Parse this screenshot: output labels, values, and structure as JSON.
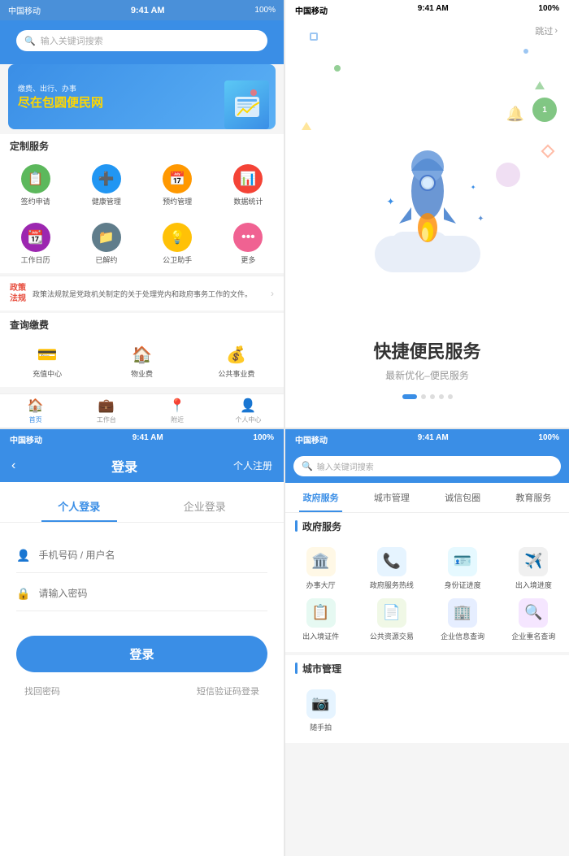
{
  "panel1": {
    "status": {
      "carrier": "中国移动",
      "time": "9:41 AM",
      "battery": "100%"
    },
    "search_placeholder": "输入关键词搜索",
    "banner": {
      "sub": "缴费、出行、办事",
      "title": "尽在包圆便民网"
    },
    "section_title": "定制服务",
    "icons_row1": [
      {
        "label": "签约申请",
        "color": "#5cb85c",
        "emoji": "📋"
      },
      {
        "label": "健康管理",
        "color": "#2196f3",
        "emoji": "💊"
      },
      {
        "label": "预约管理",
        "color": "#ff9800",
        "emoji": "📅"
      },
      {
        "label": "数据统计",
        "color": "#f44336",
        "emoji": "📊"
      }
    ],
    "icons_row2": [
      {
        "label": "工作日历",
        "color": "#9c27b0",
        "emoji": "📆"
      },
      {
        "label": "已解约",
        "color": "#607d8b",
        "emoji": "📁"
      },
      {
        "label": "公卫助手",
        "color": "#ffc107",
        "emoji": "💡"
      },
      {
        "label": "更多",
        "color": "#f06292",
        "emoji": "••• "
      }
    ],
    "policy": {
      "tag": "政策\n法规",
      "desc": "政策法规就是党政机关制定的关于处理党内和政府事务工作的文件。"
    },
    "query_section": "查询缴费",
    "query_items": [
      {
        "label": "充值中心",
        "emoji": "💳"
      },
      {
        "label": "物业费",
        "emoji": "🏠"
      },
      {
        "label": "公共事业费",
        "emoji": "💰"
      }
    ],
    "nav": [
      {
        "label": "首页",
        "emoji": "🏠",
        "active": true
      },
      {
        "label": "工作台",
        "emoji": "💼",
        "active": false
      },
      {
        "label": "附近",
        "emoji": "📍",
        "active": false
      },
      {
        "label": "个人中心",
        "emoji": "👤",
        "active": false
      }
    ]
  },
  "panel2": {
    "status": {
      "carrier": "中国移动",
      "time": "9:41 AM",
      "battery": "100%"
    },
    "skip_label": "跳过",
    "title": "快捷便民服务",
    "subtitle": "最新优化–便民服务",
    "dots": [
      true,
      false,
      false,
      false,
      false
    ]
  },
  "panel3": {
    "status": {
      "carrier": "中国移动",
      "time": "9:41 AM",
      "battery": "100%"
    },
    "header_title": "登录",
    "register_label": "个人注册",
    "back_label": "‹",
    "tabs": [
      {
        "label": "个人登录",
        "active": true
      },
      {
        "label": "企业登录",
        "active": false
      }
    ],
    "phone_placeholder": "手机号码 / 用户名",
    "password_placeholder": "请输入密码",
    "login_button": "登录",
    "forgot_password": "找回密码",
    "sms_login": "短信验证码登录"
  },
  "panel4": {
    "status": {
      "carrier": "中国移动",
      "time": "9:41 AM",
      "battery": "100%"
    },
    "search_placeholder": "输入关键词搜索",
    "nav_tabs": [
      {
        "label": "政府服务",
        "active": true
      },
      {
        "label": "城市管理",
        "active": false
      },
      {
        "label": "诚信包圈",
        "active": false
      },
      {
        "label": "教育服务",
        "active": false
      }
    ],
    "sections": [
      {
        "title": "政府服务",
        "services": [
          {
            "label": "办事大厅",
            "emoji": "🏛️",
            "bg": "#fff8e6"
          },
          {
            "label": "政府服务热线",
            "emoji": "📞",
            "bg": "#e6f4ff"
          },
          {
            "label": "身份证进度",
            "emoji": "🪪",
            "bg": "#e6f9ff"
          },
          {
            "label": "出入境进度",
            "emoji": "✈️",
            "bg": "#f0f0f0"
          },
          {
            "label": "出入境证件",
            "emoji": "📋",
            "bg": "#e6f9f2"
          },
          {
            "label": "公共资源交易",
            "emoji": "📄",
            "bg": "#f0f8e6"
          },
          {
            "label": "企业信息查询",
            "emoji": "🏢",
            "bg": "#e6eeff"
          },
          {
            "label": "企业重名查询",
            "emoji": "🔍",
            "bg": "#f5e6ff"
          }
        ]
      },
      {
        "title": "城市管理",
        "services": [
          {
            "label": "随手拍",
            "emoji": "📷",
            "bg": "#e6f4ff"
          }
        ]
      }
    ]
  }
}
